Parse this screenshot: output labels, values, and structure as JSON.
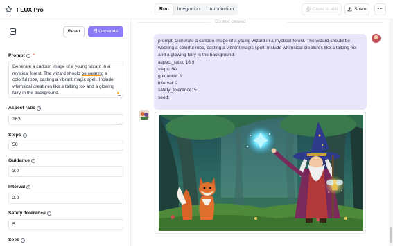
{
  "app": {
    "title": "FLUX Pro"
  },
  "tabs": [
    {
      "label": "Run",
      "active": true
    },
    {
      "label": "Integration",
      "active": false
    },
    {
      "label": "Introduction",
      "active": false
    }
  ],
  "header": {
    "clone_label": "Clone to edit",
    "share_label": "Share",
    "more_label": "···"
  },
  "form": {
    "reset_label": "Reset",
    "generate_label": "Generate",
    "prompt_label": "Prompt",
    "prompt_required": "*",
    "prompt_lines": [
      "Generate a cartoon image of a young wizard in a",
      "mystical forest. The wizard should ",
      "be wearing",
      " a",
      "colorful robe, casting a vibrant magic spell. Include",
      "whimsical creatures like a talking fox and a glowing",
      "fairy in the background."
    ],
    "aspect_ratio_label": "Aspect ratio",
    "aspect_ratio_value": "16:9",
    "steps_label": "Steps",
    "steps_value": "50",
    "guidance_label": "Guidance",
    "guidance_value": "3.0",
    "interval_label": "Interval",
    "interval_value": "2.0",
    "safety_label": "Safety Tolerance",
    "safety_value": "5",
    "seed_label": "Seed"
  },
  "chat": {
    "context_notice": "Context cleared",
    "user_message_lines": [
      "prompt: Generate a cartoon image of a young wizard in a mystical forest. The wizard should be",
      "wearing a colorful robe, casting a vibrant magic spell. Include whimsical creatures like a talking fox",
      "and a glowing fairy in the background.",
      "aspect_ratio: 16:9",
      "steps: 50",
      "guidance: 3",
      "interval: 2",
      "safety_tolerance: 5",
      "seed:"
    ]
  },
  "colors": {
    "accent": "#8b7cf6",
    "bubble": "#e9e5fb"
  },
  "icons": [
    "star-icon",
    "panel-icon",
    "sparkle-icon",
    "share-icon",
    "more-icon",
    "info-icon",
    "chevron-down-icon"
  ]
}
